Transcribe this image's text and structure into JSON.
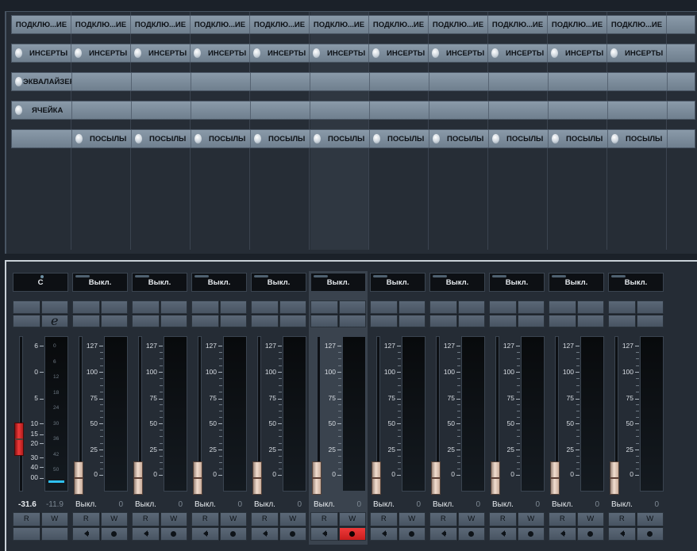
{
  "colors": {
    "panel_bg": "#262d36",
    "strip_bg": "#8a9aa9",
    "automation_write_active": "#d92a2a",
    "meter_peak": "#2fc0ee",
    "fader_cap": "#f1ddd0",
    "master_fader_cap": "#ef3a3a"
  },
  "rack": {
    "connections": [
      "ПОДКЛЮ...ИЕ",
      "ПОДКЛЮ...ИЕ",
      "ПОДКЛЮ...ИЕ",
      "ПОДКЛЮ...ИЕ",
      "ПОДКЛЮ...ИЕ",
      "ПОДКЛЮ...ИЕ",
      "ПОДКЛЮ...ИЕ",
      "ПОДКЛЮ...ИЕ",
      "ПОДКЛЮ...ИЕ",
      "ПОДКЛЮ...ИЕ",
      "ПОДКЛЮ...ИЕ"
    ],
    "inserts_label": "ИНСЕРТЫ",
    "equalizer_label": "ЭКВАЛАЙЗЕР",
    "cell_label": "ЯЧЕЙКА",
    "sends_label": "ПОСЫЛЫ"
  },
  "mixer": {
    "master": {
      "name": "C",
      "edit_icon_glyph": "e",
      "scale": [
        "6",
        "0",
        "5",
        "10",
        "15",
        "20",
        "30",
        "40",
        "00"
      ],
      "meter_scale": [
        "0",
        "6",
        "12",
        "18",
        "24",
        "30",
        "36",
        "42",
        "50"
      ],
      "volume": "-31.6",
      "pan": "-11.9",
      "fader_level_fraction": 0.2,
      "read_label": "R",
      "write_label": "W"
    },
    "channel_scale": [
      "127",
      "100",
      "75",
      "50",
      "25",
      "0"
    ],
    "channels": [
      {
        "name": "Выкл.",
        "volume": "Выкл.",
        "pan": "0",
        "read": "R",
        "write": "W",
        "write_armed": false,
        "selected": false
      },
      {
        "name": "Выкл.",
        "volume": "Выкл.",
        "pan": "0",
        "read": "R",
        "write": "W",
        "write_armed": false,
        "selected": false
      },
      {
        "name": "Выкл.",
        "volume": "Выкл.",
        "pan": "0",
        "read": "R",
        "write": "W",
        "write_armed": false,
        "selected": false
      },
      {
        "name": "Выкл.",
        "volume": "Выкл.",
        "pan": "0",
        "read": "R",
        "write": "W",
        "write_armed": false,
        "selected": false
      },
      {
        "name": "Выкл.",
        "volume": "Выкл.",
        "pan": "0",
        "read": "R",
        "write": "W",
        "write_armed": true,
        "selected": true
      },
      {
        "name": "Выкл.",
        "volume": "Выкл.",
        "pan": "0",
        "read": "R",
        "write": "W",
        "write_armed": false,
        "selected": false
      },
      {
        "name": "Выкл.",
        "volume": "Выкл.",
        "pan": "0",
        "read": "R",
        "write": "W",
        "write_armed": false,
        "selected": false
      },
      {
        "name": "Выкл.",
        "volume": "Выкл.",
        "pan": "0",
        "read": "R",
        "write": "W",
        "write_armed": false,
        "selected": false
      },
      {
        "name": "Выкл.",
        "volume": "Выкл.",
        "pan": "0",
        "read": "R",
        "write": "W",
        "write_armed": false,
        "selected": false
      },
      {
        "name": "Выкл.",
        "volume": "Выкл.",
        "pan": "0",
        "read": "R",
        "write": "W",
        "write_armed": false,
        "selected": false
      }
    ]
  }
}
